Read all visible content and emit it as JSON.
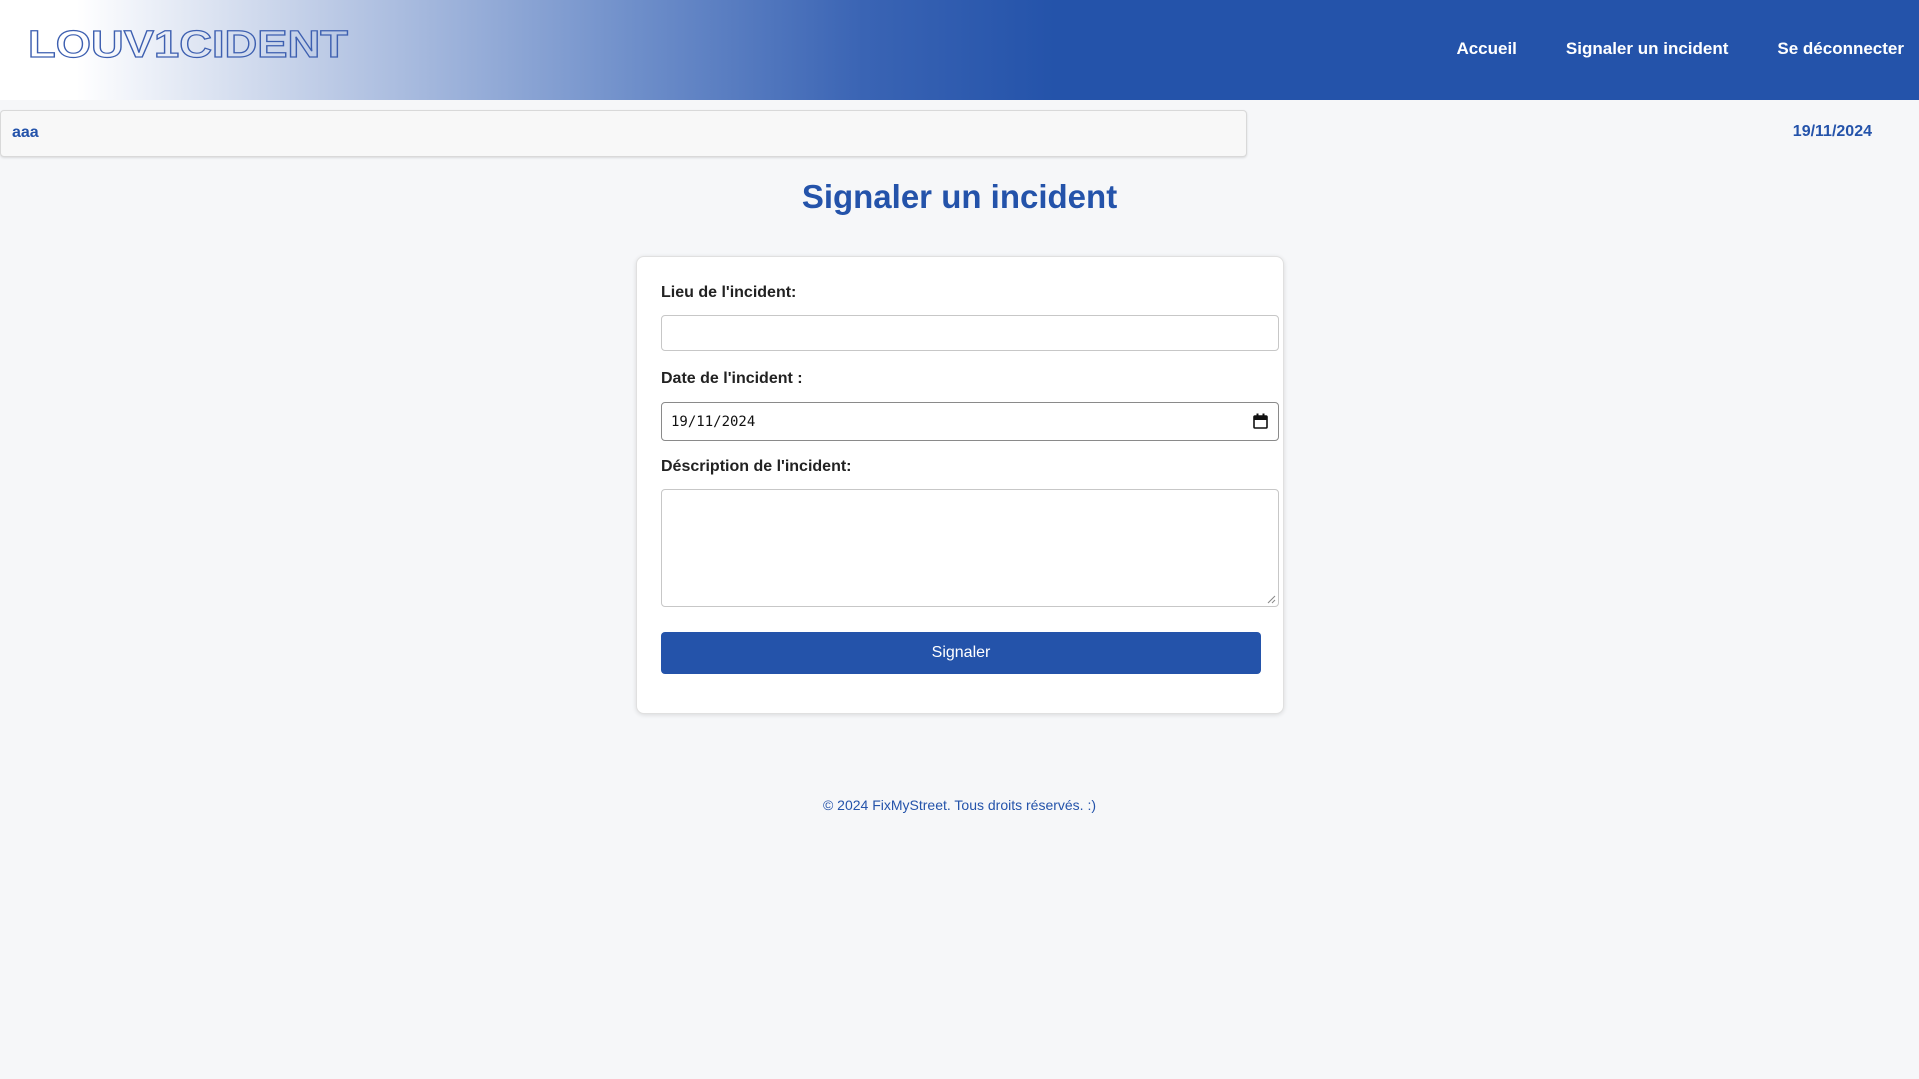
{
  "header": {
    "logo_text": "LOUV1CIDENT",
    "nav": {
      "home": "Accueil",
      "report": "Signaler un incident",
      "logout": "Se déconnecter"
    }
  },
  "user": {
    "name": "aaa"
  },
  "current_date": "19/11/2024",
  "page": {
    "title": "Signaler un incident"
  },
  "form": {
    "location": {
      "label": "Lieu de l'incident:",
      "value": ""
    },
    "date": {
      "label": "Date de l'incident :",
      "value": "19/11/2024",
      "icon": "calendar-icon"
    },
    "description": {
      "label": "Déscription de l'incident:",
      "value": ""
    },
    "submit_label": "Signaler"
  },
  "footer": {
    "text": "© 2024 FixMyStreet. Tous droits réservés. :)"
  },
  "colors": {
    "brand": "#2453aa",
    "background": "#f6f7f9"
  }
}
